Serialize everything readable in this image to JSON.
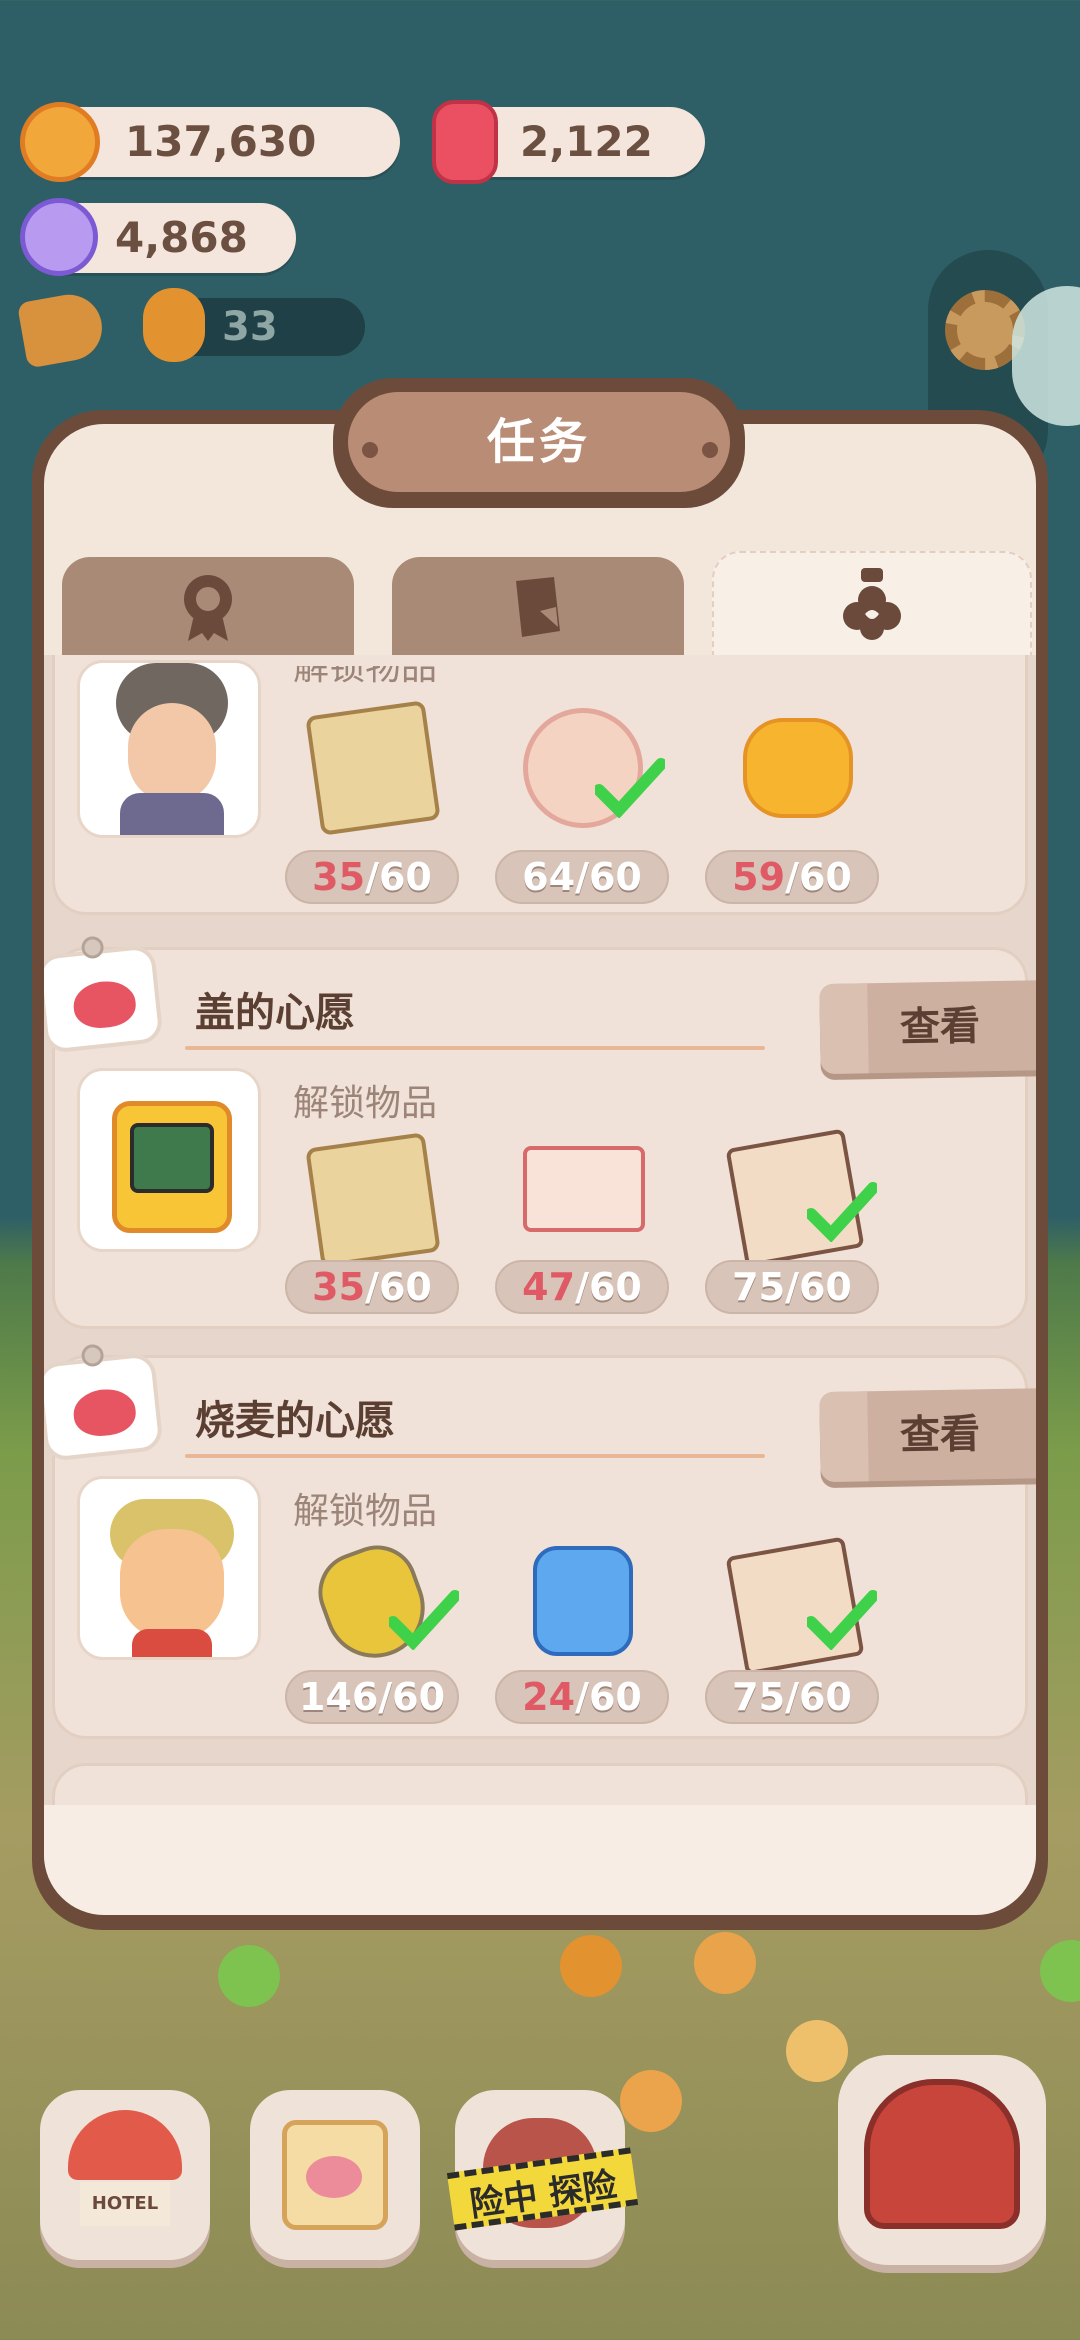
{
  "currencies": {
    "cookie": {
      "value": "137,630",
      "icon": "cookie-coin-icon"
    },
    "candle": {
      "value": "2,122",
      "icon": "red-candle-icon"
    },
    "candy": {
      "value": "4,868",
      "icon": "purple-candy-icon"
    },
    "gingerbread": {
      "value": "33",
      "icon": "gingerbread-icon"
    }
  },
  "panel": {
    "title": "任务",
    "tabs": [
      {
        "icon": "badge-icon",
        "active": false
      },
      {
        "icon": "note-icon",
        "active": false
      },
      {
        "icon": "flower-bottle-icon",
        "active": true
      }
    ]
  },
  "wishes": [
    {
      "title": "",
      "unlock_label": "解锁物品",
      "items": [
        {
          "icon": "paper-bag-icon",
          "have": "35",
          "need": "/60",
          "done": false
        },
        {
          "icon": "pink-cushion-icon",
          "have": "64",
          "need": "/60",
          "done": true
        },
        {
          "icon": "sleep-slippers-icon",
          "have": "59",
          "need": "/60",
          "done": false
        }
      ]
    },
    {
      "title": "盖的心愿",
      "button": "查看",
      "unlock_label": "解锁物品",
      "items": [
        {
          "icon": "paper-bag-icon",
          "have": "35",
          "need": "/60",
          "done": false
        },
        {
          "icon": "comic-book-icon",
          "have": "47",
          "need": "/60",
          "done": false
        },
        {
          "icon": "newspaper-icon",
          "have": "75",
          "need": "/60",
          "done": true
        }
      ]
    },
    {
      "title": "烧麦的心愿",
      "button": "查看",
      "unlock_label": "解锁物品",
      "items": [
        {
          "icon": "spoon-icon",
          "have": "146",
          "need": "/60",
          "done": true
        },
        {
          "icon": "detergent-icon",
          "have": "24",
          "need": "/60",
          "done": false
        },
        {
          "icon": "newspaper-icon",
          "have": "75",
          "need": "/60",
          "done": true
        }
      ]
    }
  ],
  "bottom_nav": {
    "hotel_label": "HOTEL",
    "tape_text": "险中 探险"
  },
  "colors": {
    "accent_red": "#e05a66",
    "panel_brown": "#6d4b3b",
    "check_green": "#3fd14a"
  }
}
